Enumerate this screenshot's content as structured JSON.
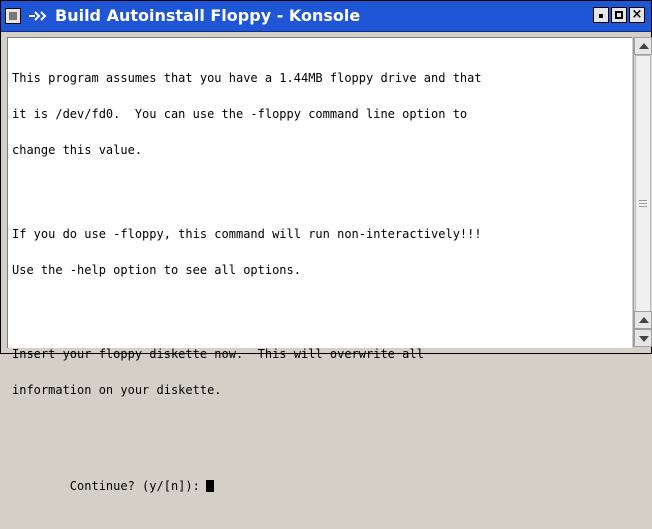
{
  "window": {
    "title": "Build Autoinstall Floppy - Konsole"
  },
  "titlebar": {
    "buttons": {
      "close_label": "×"
    }
  },
  "terminal": {
    "lines": [
      "This program assumes that you have a 1.44MB floppy drive and that",
      "it is /dev/fd0.  You can use the -floppy command line option to",
      "change this value.",
      "",
      "If you do use -floppy, this command will run non-interactively!!!",
      "Use the -help option to see all options.",
      "",
      "Insert your floppy diskette now.  This will overwrite all",
      "information on your diskette.",
      ""
    ],
    "prompt": "Continue? (y/[n]):"
  }
}
